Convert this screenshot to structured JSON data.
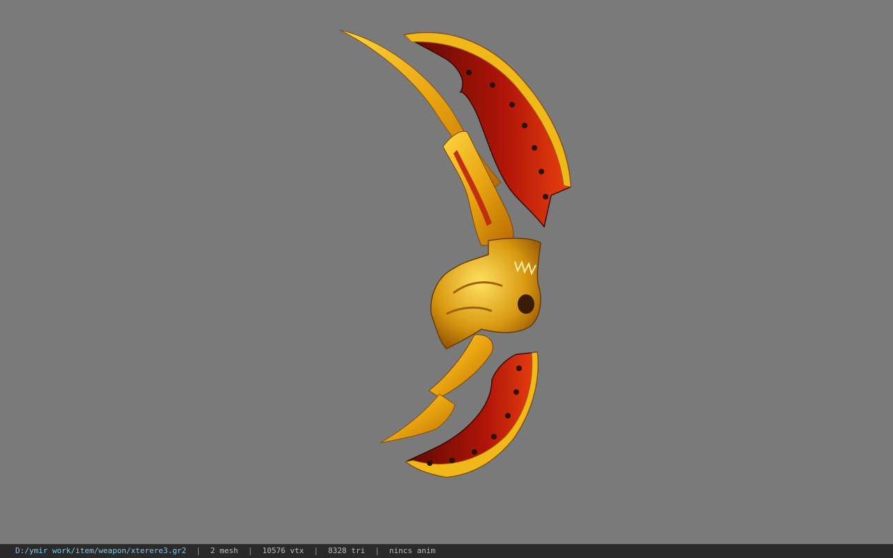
{
  "viewer": {
    "background_color": "#7a7a7a",
    "model_name": "xterere3",
    "model_colors": {
      "gold": "#e8a410",
      "gold_light": "#ffd640",
      "red": "#b01408",
      "dark_red": "#5a0a04",
      "dark": "#2a1204"
    }
  },
  "statusbar": {
    "file_path": "D:/ymir work/item/weapon/xterere3.gr2",
    "separator": "|",
    "mesh_count": "2 mesh",
    "vertex_count": "10576 vtx",
    "triangle_count": "8328 tri",
    "anim_status": "nincs anim"
  }
}
